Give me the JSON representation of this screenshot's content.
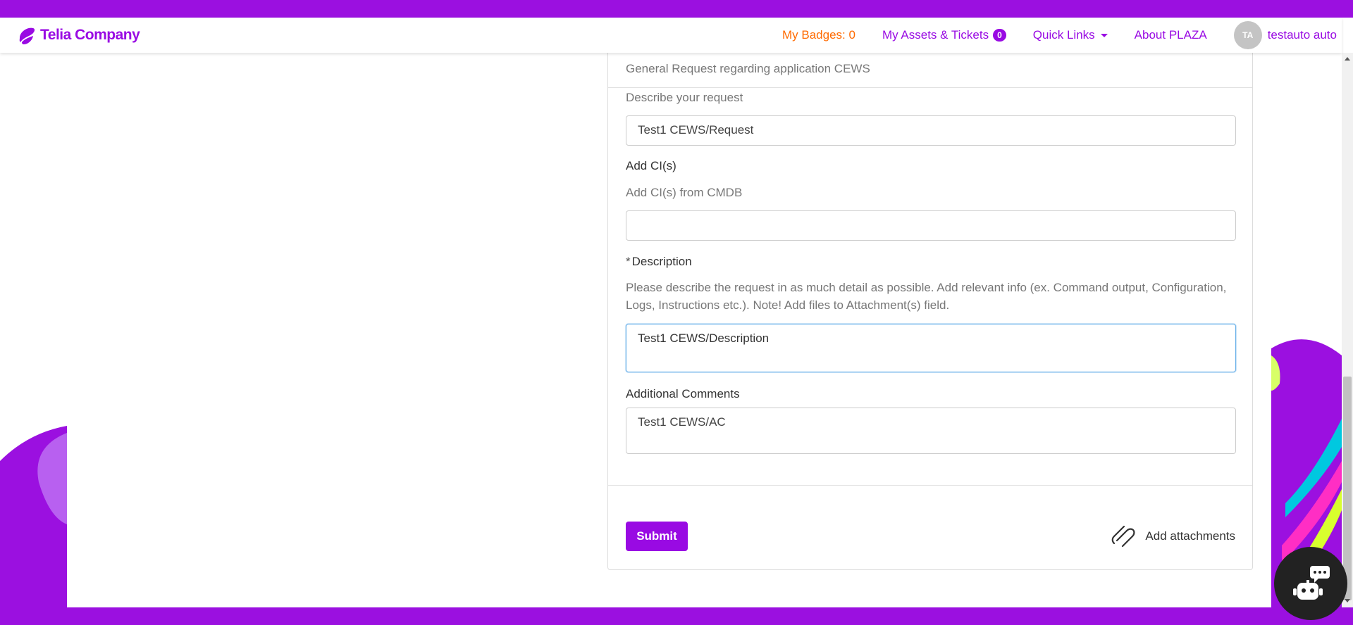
{
  "header": {
    "brand": "Telia Company",
    "badges_label": "My Badges: 0",
    "assets_label": "My Assets & Tickets",
    "assets_count": "0",
    "quick_links_label": "Quick Links",
    "about_label": "About PLAZA",
    "user_initials": "TA",
    "user_name": "testauto auto"
  },
  "form": {
    "request_title": "General Request regarding application CEWS",
    "describe_request_label": "Describe your request",
    "describe_request_value": "Test1 CEWS/Request",
    "add_ci_label": "Add CI(s)",
    "add_ci_help": "Add CI(s) from CMDB",
    "add_ci_value": "",
    "description_required_mark": "*",
    "description_label": "Description",
    "description_help": "Please describe the request in as much detail as possible. Add relevant info (ex. Command output, Configuration, Logs, Instructions etc.). Note! Add files to Attachment(s) field.",
    "description_value": "Test1 CEWS/Description",
    "additional_comments_label": "Additional Comments",
    "additional_comments_value": "Test1 CEWS/AC",
    "submit_label": "Submit",
    "attachments_label": "Add attachments"
  },
  "colors": {
    "brand_purple": "#990ae3",
    "badge_orange": "#ff6a00",
    "chatbot_bg": "#222222"
  }
}
